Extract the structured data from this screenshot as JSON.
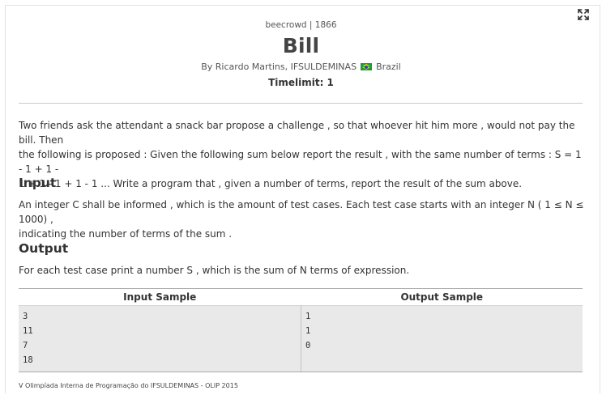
{
  "header": {
    "brand": "beecrowd | 1866",
    "title": "Bill",
    "author_prefix": "By Ricardo Martins, IFSULDEMINAS",
    "country": "Brazil",
    "timelimit": "Timelimit: 1"
  },
  "problem": {
    "description_lines": [
      "Two friends ask the attendant a snack bar propose a challenge , so that whoever hit him more , would not pay the bill. Then",
      "the following is proposed : Given the following sum below report the result , with the same number of terms : S = 1 - 1 + 1 -",
      "1 + 1 - 1 + 1 - 1 ... Write a program that , given a number of terms, report the result of the sum above."
    ],
    "input_heading": "Input",
    "input_lines": [
      "An integer C shall be informed , which is the amount of test cases. Each test case starts with an integer N ( 1 ≤ N ≤ 1000) ,",
      "indicating the number of terms of the sum ."
    ],
    "output_heading": "Output",
    "output_text": "For each test case print a number S , which is the sum of N terms of expression."
  },
  "samples": {
    "input_header": "Input Sample",
    "output_header": "Output Sample",
    "input_lines": [
      "3",
      "11",
      "7",
      "18"
    ],
    "output_lines": [
      "1",
      "1",
      "0"
    ]
  },
  "footer": "V Olimpíada Interna de Programação do IFSULDEMINAS - OLIP 2015",
  "icons": {
    "expand": "expand-icon",
    "flag": "brazil-flag-icon"
  },
  "colors": {
    "flag_green": "#1e9a3a",
    "flag_yellow": "#f5d20b",
    "sample_bg": "#e9e9e9"
  }
}
